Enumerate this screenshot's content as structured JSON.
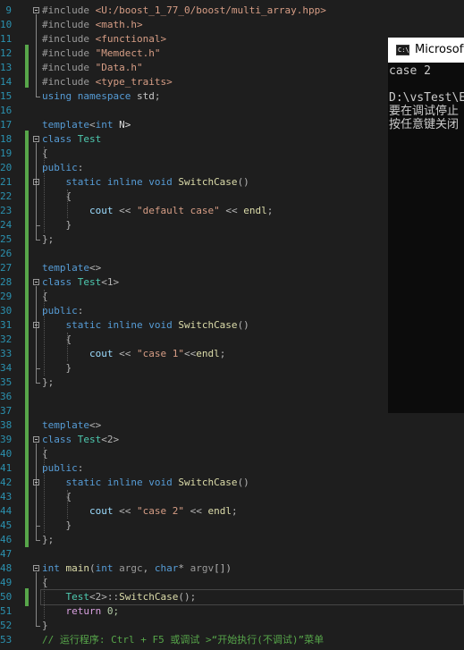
{
  "editor": {
    "lines": [
      {
        "num": "9",
        "tokens": [
          {
            "t": "#include ",
            "c": "#9b9b9b"
          },
          {
            "t": "<U:/boost_1_77_0/boost/multi_array.hpp>",
            "c": "#d69d85"
          }
        ]
      },
      {
        "num": "10",
        "tokens": [
          {
            "t": "#include ",
            "c": "#9b9b9b"
          },
          {
            "t": "<math.h>",
            "c": "#d69d85"
          }
        ]
      },
      {
        "num": "11",
        "tokens": [
          {
            "t": "#include ",
            "c": "#9b9b9b"
          },
          {
            "t": "<functional>",
            "c": "#d69d85"
          }
        ]
      },
      {
        "num": "12",
        "tokens": [
          {
            "t": "#include ",
            "c": "#9b9b9b"
          },
          {
            "t": "\"Memdect.h\"",
            "c": "#d69d85"
          }
        ]
      },
      {
        "num": "13",
        "tokens": [
          {
            "t": "#include ",
            "c": "#9b9b9b"
          },
          {
            "t": "\"Data.h\"",
            "c": "#d69d85"
          }
        ]
      },
      {
        "num": "14",
        "tokens": [
          {
            "t": "#include ",
            "c": "#9b9b9b"
          },
          {
            "t": "<type_traits>",
            "c": "#d69d85"
          }
        ]
      },
      {
        "num": "15",
        "tokens": [
          {
            "t": "using namespace ",
            "c": "#569cd6"
          },
          {
            "t": "std",
            "c": "#c8c8c8"
          },
          {
            "t": ";",
            "c": "#b4b4b4"
          }
        ]
      },
      {
        "num": "16",
        "tokens": []
      },
      {
        "num": "17",
        "tokens": [
          {
            "t": "template",
            "c": "#569cd6"
          },
          {
            "t": "<",
            "c": "#b4b4b4"
          },
          {
            "t": "int",
            "c": "#569cd6"
          },
          {
            "t": " N>",
            "c": "#dcdcdc"
          }
        ]
      },
      {
        "num": "18",
        "tokens": [
          {
            "t": "class ",
            "c": "#569cd6"
          },
          {
            "t": "Test",
            "c": "#4ec9b0"
          }
        ]
      },
      {
        "num": "19",
        "tokens": [
          {
            "t": "{",
            "c": "#b4b4b4"
          }
        ]
      },
      {
        "num": "20",
        "tokens": [
          {
            "t": "public",
            "c": "#569cd6"
          },
          {
            "t": ":",
            "c": "#b4b4b4"
          }
        ]
      },
      {
        "num": "21",
        "tokens": [
          {
            "t": "    static inline void ",
            "c": "#569cd6"
          },
          {
            "t": "SwitchCase",
            "c": "#dcdcaa"
          },
          {
            "t": "()",
            "c": "#b4b4b4"
          }
        ]
      },
      {
        "num": "22",
        "tokens": [
          {
            "t": "    {",
            "c": "#b4b4b4"
          }
        ]
      },
      {
        "num": "23",
        "tokens": [
          {
            "t": "        cout",
            "c": "#9cdcfe"
          },
          {
            "t": " << ",
            "c": "#b4b4b4"
          },
          {
            "t": "\"default case\"",
            "c": "#d69d85"
          },
          {
            "t": " << ",
            "c": "#b4b4b4"
          },
          {
            "t": "endl",
            "c": "#dcdcaa"
          },
          {
            "t": ";",
            "c": "#b4b4b4"
          }
        ]
      },
      {
        "num": "24",
        "tokens": [
          {
            "t": "    }",
            "c": "#b4b4b4"
          }
        ]
      },
      {
        "num": "25",
        "tokens": [
          {
            "t": "};",
            "c": "#b4b4b4"
          }
        ]
      },
      {
        "num": "26",
        "tokens": []
      },
      {
        "num": "27",
        "tokens": [
          {
            "t": "template",
            "c": "#569cd6"
          },
          {
            "t": "<>",
            "c": "#b4b4b4"
          }
        ]
      },
      {
        "num": "28",
        "tokens": [
          {
            "t": "class ",
            "c": "#569cd6"
          },
          {
            "t": "Test",
            "c": "#4ec9b0"
          },
          {
            "t": "<1>",
            "c": "#b4b4b4"
          }
        ]
      },
      {
        "num": "29",
        "tokens": [
          {
            "t": "{",
            "c": "#b4b4b4"
          }
        ]
      },
      {
        "num": "30",
        "tokens": [
          {
            "t": "public",
            "c": "#569cd6"
          },
          {
            "t": ":",
            "c": "#b4b4b4"
          }
        ]
      },
      {
        "num": "31",
        "tokens": [
          {
            "t": "    static inline void ",
            "c": "#569cd6"
          },
          {
            "t": "SwitchCase",
            "c": "#dcdcaa"
          },
          {
            "t": "()",
            "c": "#b4b4b4"
          }
        ]
      },
      {
        "num": "32",
        "tokens": [
          {
            "t": "    {",
            "c": "#b4b4b4"
          }
        ]
      },
      {
        "num": "33",
        "tokens": [
          {
            "t": "        cout",
            "c": "#9cdcfe"
          },
          {
            "t": " << ",
            "c": "#b4b4b4"
          },
          {
            "t": "\"case 1\"",
            "c": "#d69d85"
          },
          {
            "t": "<<",
            "c": "#b4b4b4"
          },
          {
            "t": "endl",
            "c": "#dcdcaa"
          },
          {
            "t": ";",
            "c": "#b4b4b4"
          }
        ]
      },
      {
        "num": "34",
        "tokens": [
          {
            "t": "    }",
            "c": "#b4b4b4"
          }
        ]
      },
      {
        "num": "35",
        "tokens": [
          {
            "t": "};",
            "c": "#b4b4b4"
          }
        ]
      },
      {
        "num": "36",
        "tokens": []
      },
      {
        "num": "37",
        "tokens": []
      },
      {
        "num": "38",
        "tokens": [
          {
            "t": "template",
            "c": "#569cd6"
          },
          {
            "t": "<>",
            "c": "#b4b4b4"
          }
        ]
      },
      {
        "num": "39",
        "tokens": [
          {
            "t": "class ",
            "c": "#569cd6"
          },
          {
            "t": "Test",
            "c": "#4ec9b0"
          },
          {
            "t": "<2>",
            "c": "#b4b4b4"
          }
        ]
      },
      {
        "num": "40",
        "tokens": [
          {
            "t": "{",
            "c": "#b4b4b4"
          }
        ]
      },
      {
        "num": "41",
        "tokens": [
          {
            "t": "public",
            "c": "#569cd6"
          },
          {
            "t": ":",
            "c": "#b4b4b4"
          }
        ]
      },
      {
        "num": "42",
        "tokens": [
          {
            "t": "    static inline void ",
            "c": "#569cd6"
          },
          {
            "t": "SwitchCase",
            "c": "#dcdcaa"
          },
          {
            "t": "()",
            "c": "#b4b4b4"
          }
        ]
      },
      {
        "num": "43",
        "tokens": [
          {
            "t": "    {",
            "c": "#b4b4b4"
          }
        ]
      },
      {
        "num": "44",
        "tokens": [
          {
            "t": "        cout",
            "c": "#9cdcfe"
          },
          {
            "t": " << ",
            "c": "#b4b4b4"
          },
          {
            "t": "\"case 2\"",
            "c": "#d69d85"
          },
          {
            "t": " << ",
            "c": "#b4b4b4"
          },
          {
            "t": "endl",
            "c": "#dcdcaa"
          },
          {
            "t": ";",
            "c": "#b4b4b4"
          }
        ]
      },
      {
        "num": "45",
        "tokens": [
          {
            "t": "    }",
            "c": "#b4b4b4"
          }
        ]
      },
      {
        "num": "46",
        "tokens": [
          {
            "t": "};",
            "c": "#b4b4b4"
          }
        ]
      },
      {
        "num": "47",
        "tokens": []
      },
      {
        "num": "48",
        "tokens": [
          {
            "t": "int ",
            "c": "#569cd6"
          },
          {
            "t": "main",
            "c": "#dcdcaa"
          },
          {
            "t": "(",
            "c": "#b4b4b4"
          },
          {
            "t": "int ",
            "c": "#569cd6"
          },
          {
            "t": "argc",
            "c": "#9a9a9a"
          },
          {
            "t": ", ",
            "c": "#b4b4b4"
          },
          {
            "t": "char",
            "c": "#569cd6"
          },
          {
            "t": "* ",
            "c": "#b4b4b4"
          },
          {
            "t": "argv",
            "c": "#9a9a9a"
          },
          {
            "t": "[])",
            "c": "#b4b4b4"
          }
        ]
      },
      {
        "num": "49",
        "tokens": [
          {
            "t": "{",
            "c": "#b4b4b4"
          }
        ]
      },
      {
        "num": "50",
        "tokens": [
          {
            "t": "    Test",
            "c": "#4ec9b0"
          },
          {
            "t": "<2>::",
            "c": "#b4b4b4"
          },
          {
            "t": "SwitchCase",
            "c": "#dcdcaa"
          },
          {
            "t": "();",
            "c": "#b4b4b4"
          }
        ]
      },
      {
        "num": "51",
        "tokens": [
          {
            "t": "    return ",
            "c": "#d8a0df"
          },
          {
            "t": "0;",
            "c": "#b5cea8"
          }
        ]
      },
      {
        "num": "52",
        "tokens": [
          {
            "t": "}",
            "c": "#b4b4b4"
          }
        ]
      },
      {
        "num": "53",
        "tokens": [
          {
            "t": "// 运行程序: Ctrl + F5 或调试 >“开始执行(不调试)”菜单",
            "c": "#57a64a"
          }
        ]
      }
    ]
  },
  "console": {
    "title": "Microsoft",
    "lines": [
      "case 2",
      "",
      "D:\\vsTest\\E",
      "要在调试停止",
      "按任意键关闭"
    ]
  },
  "colors": {
    "editor_bg": "#1e1e1e",
    "line_number": "#2b91af",
    "change_bar": "#57a64a",
    "console_bg": "#0c0c0c"
  }
}
